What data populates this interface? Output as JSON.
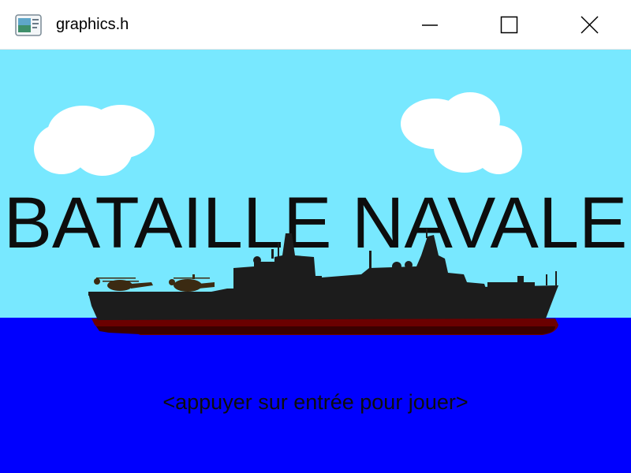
{
  "window": {
    "title": "graphics.h",
    "app_icon": "window-app-icon",
    "controls": {
      "minimize_icon": "minimize-icon",
      "maximize_icon": "maximize-icon",
      "close_icon": "close-icon"
    }
  },
  "game": {
    "title": "BATAILLE NAVALE",
    "prompt": "<appuyer sur entrée pour jouer>"
  },
  "colors": {
    "sky": "#78E8FF",
    "sea": "#0000FE",
    "ship": "#1c1c1c",
    "hull_waterline": "#6b0000",
    "cloud": "#ffffff",
    "text": "#0d0d0d"
  }
}
